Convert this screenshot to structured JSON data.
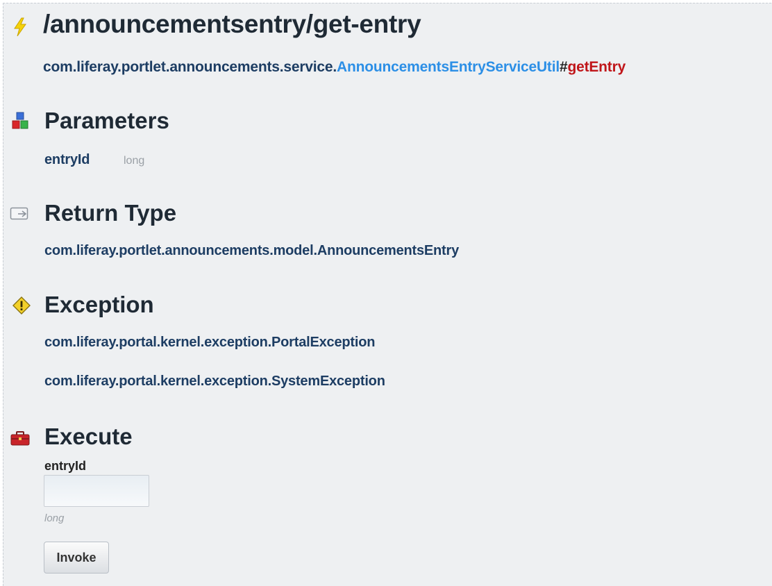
{
  "header": {
    "title": "/announcementsentry/get-entry",
    "class_package": "com.liferay.portlet.announcements.service.",
    "class_name": "AnnouncementsEntryServiceUtil",
    "hash": "#",
    "method_name": "getEntry"
  },
  "parameters": {
    "heading": "Parameters",
    "items": [
      {
        "name": "entryId",
        "type": "long"
      }
    ]
  },
  "return_type": {
    "heading": "Return Type",
    "value": "com.liferay.portlet.announcements.model.AnnouncementsEntry"
  },
  "exception": {
    "heading": "Exception",
    "items": [
      "com.liferay.portal.kernel.exception.PortalException",
      "com.liferay.portal.kernel.exception.SystemException"
    ]
  },
  "execute": {
    "heading": "Execute",
    "field_label": "entryId",
    "field_value": "",
    "field_type_hint": "long",
    "button_label": "Invoke"
  },
  "icons": {
    "title": "lightning-bolt-icon",
    "parameters": "blocks-icon",
    "return_type": "return-icon",
    "exception": "warning-icon",
    "execute": "toolbox-icon"
  },
  "colors": {
    "background": "#eef0f2",
    "heading": "#1f2a35",
    "link_dark": "#1d3d63",
    "link_bright": "#2c8fe6",
    "method": "#c0161a",
    "muted": "#9aa0a6"
  }
}
